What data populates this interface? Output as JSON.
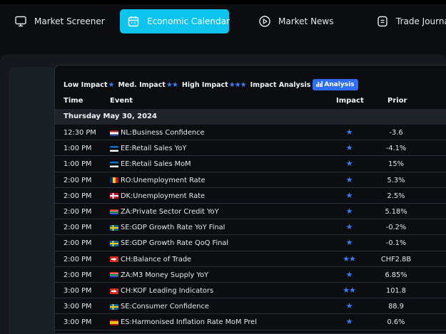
{
  "nav": {
    "items": [
      {
        "label": "Market Screener",
        "icon": "monitor-icon"
      },
      {
        "label": "Economic Calendar",
        "icon": "calendar-icon",
        "active": true
      },
      {
        "label": "Market News",
        "icon": "play-circle-icon"
      },
      {
        "label": "Trade Journa",
        "icon": "journal-icon"
      }
    ]
  },
  "legend": {
    "low": "Low Impact",
    "med": "Med. Impact",
    "high": "High Impact",
    "analysis_label": "Impact Analysis",
    "analysis_button": "Analysis"
  },
  "table": {
    "headers": {
      "time": "Time",
      "event": "Event",
      "impact": "Impact",
      "prior": "Prior"
    },
    "date": "Thursday May 30, 2024",
    "rows": [
      {
        "time": "12:30 PM",
        "event": "NL:Business Confidence",
        "impact": "★",
        "prior": "-3.6",
        "flag": "nl"
      },
      {
        "time": "1:00 PM",
        "event": "EE:Retail Sales YoY",
        "impact": "★",
        "prior": "-4.1%",
        "flag": "ee"
      },
      {
        "time": "1:00 PM",
        "event": "EE:Retail Sales MoM",
        "impact": "★",
        "prior": "15%",
        "flag": "ee"
      },
      {
        "time": "2:00 PM",
        "event": "RO:Unemployment Rate",
        "impact": "★",
        "prior": "5.3%",
        "flag": "ro"
      },
      {
        "time": "2:00 PM",
        "event": "DK:Unemployment Rate",
        "impact": "★",
        "prior": "2.5%",
        "flag": "dk"
      },
      {
        "time": "2:00 PM",
        "event": "ZA:Private Sector Credit YoY",
        "impact": "★",
        "prior": "5.18%",
        "flag": "za"
      },
      {
        "time": "2:00 PM",
        "event": "SE:GDP Growth Rate YoY Final",
        "impact": "★",
        "prior": "-0.2%",
        "flag": "se"
      },
      {
        "time": "2:00 PM",
        "event": "SE:GDP Growth Rate QoQ Final",
        "impact": "★",
        "prior": "-0.1%",
        "flag": "se"
      },
      {
        "time": "2:00 PM",
        "event": "CH:Balance of Trade",
        "impact": "★★",
        "prior": "CHF2.8B",
        "flag": "ch"
      },
      {
        "time": "2:00 PM",
        "event": "ZA:M3 Money Supply YoY",
        "impact": "★",
        "prior": "6.85%",
        "flag": "za"
      },
      {
        "time": "3:00 PM",
        "event": "CH:KOF Leading Indicators",
        "impact": "★★",
        "prior": "101.8",
        "flag": "ch"
      },
      {
        "time": "3:00 PM",
        "event": "SE:Consumer Confidence",
        "impact": "★",
        "prior": "88.9",
        "flag": "se"
      },
      {
        "time": "3:00 PM",
        "event": "ES:Harmonised Inflation Rate MoM Prel",
        "impact": "★",
        "prior": "0.6%",
        "flag": "es"
      }
    ]
  },
  "colors": {
    "accent": "#0dc4ef",
    "star": "#3b7bf7",
    "analysis_button": "#2f6df6"
  }
}
